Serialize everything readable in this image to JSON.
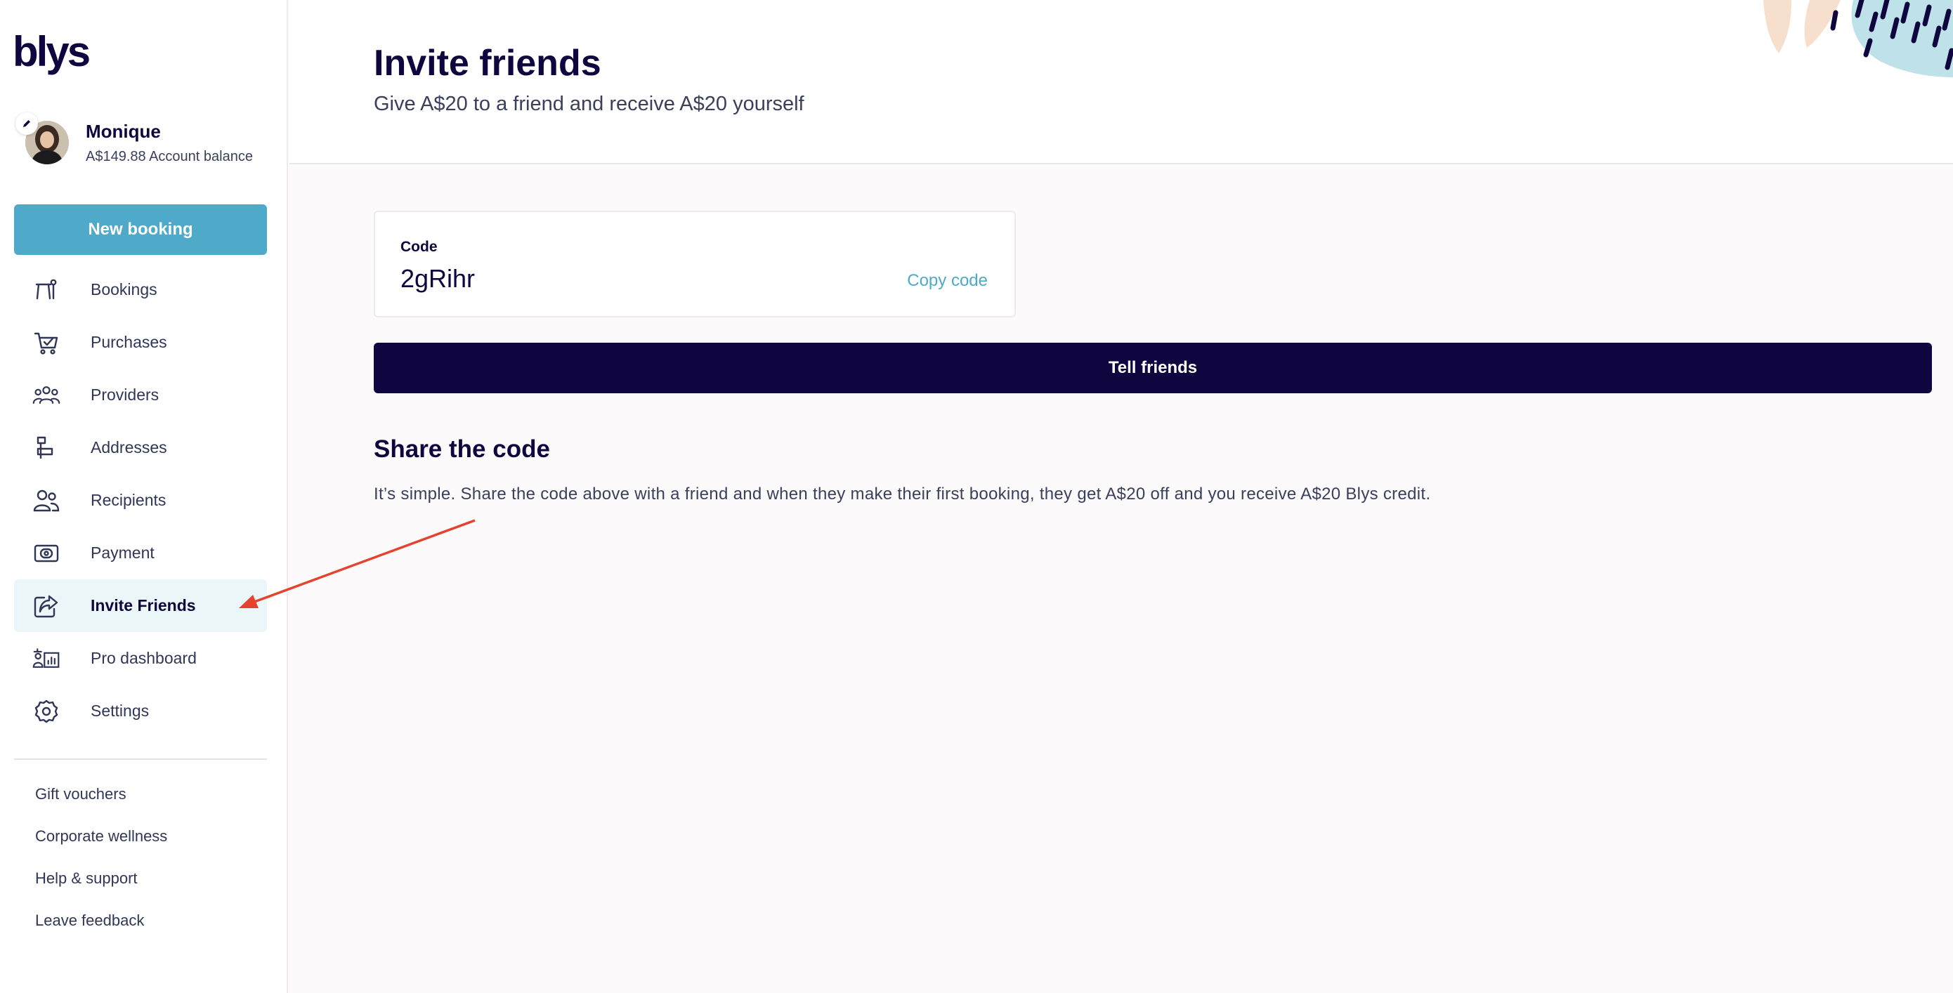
{
  "sidebar": {
    "logo": "blys",
    "profile": {
      "name": "Monique",
      "balance": "A$149.88 Account balance"
    },
    "new_booking_label": "New booking",
    "nav": [
      {
        "label": "Bookings",
        "icon": "massage-table-icon"
      },
      {
        "label": "Purchases",
        "icon": "cart-icon"
      },
      {
        "label": "Providers",
        "icon": "group-icon"
      },
      {
        "label": "Addresses",
        "icon": "mailbox-icon"
      },
      {
        "label": "Recipients",
        "icon": "people-icon"
      },
      {
        "label": "Payment",
        "icon": "wallet-icon"
      },
      {
        "label": "Invite Friends",
        "icon": "share-icon",
        "active": true
      },
      {
        "label": "Pro dashboard",
        "icon": "dashboard-icon"
      },
      {
        "label": "Settings",
        "icon": "gear-icon"
      }
    ],
    "footer_links": [
      "Gift vouchers",
      "Corporate wellness",
      "Help & support",
      "Leave feedback"
    ]
  },
  "header": {
    "title": "Invite friends",
    "subtitle": "Give A$20 to a friend and receive A$20 yourself"
  },
  "referral": {
    "code_label": "Code",
    "code_value": "2gRihr",
    "copy_label": "Copy code",
    "tell_friends_label": "Tell friends"
  },
  "share": {
    "title": "Share the code",
    "text": "It’s simple. Share the code above with a friend and when they make their first booking, they get A$20 off and you receive A$20 Blys credit."
  },
  "colors": {
    "navy": "#10063f",
    "accent_blue": "#4fa9c8",
    "active_bg": "#ebf6f8",
    "annotation_red": "#e5432d"
  }
}
